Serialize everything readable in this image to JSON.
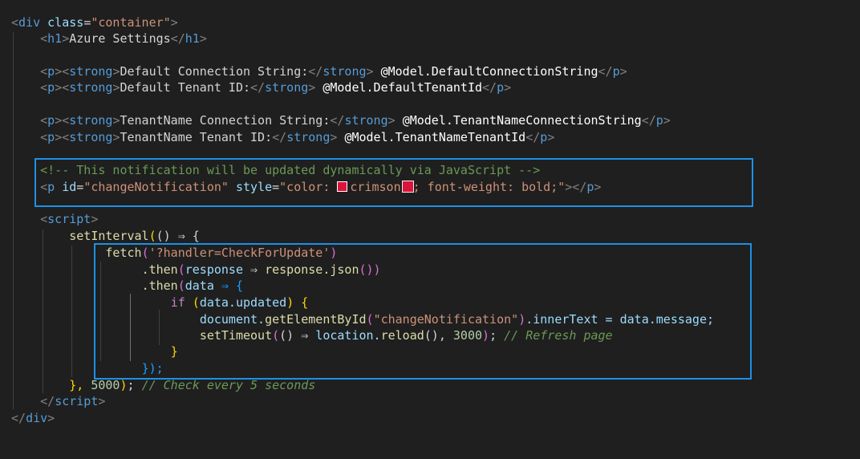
{
  "code": {
    "l1": {
      "tag": "div",
      "attr": "class",
      "eq": "=",
      "val": "\"container\""
    },
    "l2": {
      "open": "h1",
      "text": "Azure Settings",
      "close": "h1"
    },
    "l4": {
      "label": "Default Connection String:",
      "model": "@Model.DefaultConnectionString"
    },
    "l5": {
      "label": "Default Tenant ID:",
      "model": "@Model.DefaultTenantId"
    },
    "l7": {
      "label": "TenantName Connection String:",
      "model": "@Model.TenantNameConnectionString"
    },
    "l8": {
      "label": "TenantName Tenant ID:",
      "model": "@Model.TenantNameTenantId"
    },
    "l10": {
      "comment": "<!-- This notification will be updated dynamically via JavaScript -->"
    },
    "l11": {
      "id_attr": "id",
      "id_val": "\"changeNotification\"",
      "style_attr": "style",
      "style_open": "\"color: ",
      "color_word": "crimson",
      "style_rest": "; font-weight: bold;\""
    },
    "l13": {
      "tag": "script"
    },
    "l14": {
      "fn": "setInterval",
      "arrow": "() ⇒ {"
    },
    "l15": {
      "fn": "fetch",
      "arg": "'?handler=CheckForUpdate'"
    },
    "l16": {
      "then": ".then",
      "param": "response",
      "arrow": "⇒",
      "call": "response.json",
      "tail": "())"
    },
    "l17": {
      "then": ".then",
      "param": "data",
      "arrow": "⇒ {"
    },
    "l18": {
      "kw": "if",
      "cond": "data.updated",
      "brace": "{"
    },
    "l19": {
      "obj": "document.",
      "fn": "getElementById",
      "arg": "\"changeNotification\"",
      "rest": ".innerText = data.message;"
    },
    "l20": {
      "fn": "setTimeout",
      "arrow": "() ⇒",
      "obj": "location.",
      "call": "reload",
      "num": "3000",
      "comment": "// Refresh page"
    },
    "l21": {
      "brace": "}"
    },
    "l22": {
      "close": "});"
    },
    "l23": {
      "num": "5000",
      "comment": "// Check every 5 seconds"
    },
    "l24": {
      "tag": "script"
    },
    "l25": {
      "tag": "div"
    }
  },
  "p_tag": "p",
  "strong_tag": "strong"
}
